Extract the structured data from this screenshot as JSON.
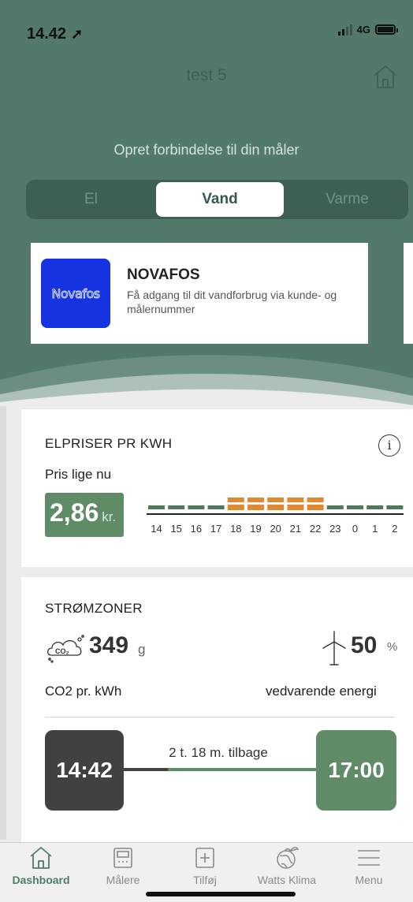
{
  "status_bar": {
    "time": "14.42",
    "location_glyph": "➚",
    "network": "4G"
  },
  "header": {
    "title": "test 5",
    "home_icon": "home-icon"
  },
  "connect": {
    "label": "Opret forbindelse til din måler",
    "tabs": [
      "El",
      "Vand",
      "Varme"
    ],
    "selected_tab": "Vand"
  },
  "provider": {
    "logo_text": "Novafos",
    "name": "NOVAFOS",
    "description": "Få adgang til dit vandforbrug via kunde- og målernummer"
  },
  "prices": {
    "title": "ELPRISER PR KWH",
    "subtitle": "Pris lige nu",
    "current_price": "2,86",
    "unit": "kr.",
    "hours": [
      "14",
      "15",
      "16",
      "17",
      "18",
      "19",
      "20",
      "21",
      "22",
      "23",
      "0",
      "1",
      "2"
    ],
    "hour_levels": [
      "low",
      "low",
      "low",
      "low",
      "high",
      "high",
      "high",
      "high",
      "high",
      "low",
      "low",
      "low",
      "low"
    ],
    "colors": {
      "low": "#4f7a5a",
      "high": "#e2892f"
    }
  },
  "zone": {
    "title": "STRØMZONER",
    "co2_value": "349",
    "co2_unit": "g",
    "co2_label": "CO2 pr. kWh",
    "renewable_value": "50",
    "renewable_unit": "%",
    "renewable_label": "vedvarende energi",
    "time_now": "14:42",
    "time_next": "17:00",
    "time_remaining": "2 t. 18 m. tilbage",
    "progress_elapsed_fraction": 0.23
  },
  "tabbar": [
    {
      "label": "Dashboard",
      "icon": "home-icon",
      "active": true
    },
    {
      "label": "Målere",
      "icon": "meter-icon",
      "active": false
    },
    {
      "label": "Tilføj",
      "icon": "add-icon",
      "active": false
    },
    {
      "label": "Watts Klima",
      "icon": "globe-icon",
      "active": false
    },
    {
      "label": "Menu",
      "icon": "menu-icon",
      "active": false
    }
  ],
  "colors": {
    "brand_green": "#52796a",
    "accent_green": "#5f8b67",
    "dark": "#414141",
    "novafos_blue": "#1533e0"
  }
}
